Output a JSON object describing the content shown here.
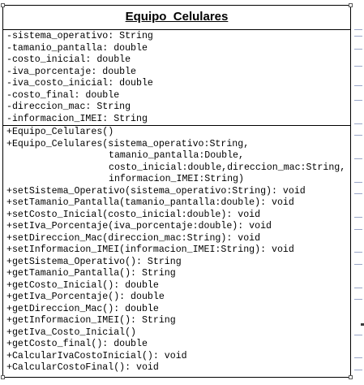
{
  "class_name": "Equipo_Celulares",
  "attributes": [
    "-sistema_operativo: String",
    "-tamanio_pantalla: double",
    "-costo_inicial: double",
    "-iva_porcentaje: double",
    "-iva_costo_inicial: double",
    "-costo_final: double",
    "-direccion_mac: String",
    "-informacion_IMEI: String"
  ],
  "constructors": [
    "+Equipo_Celulares()",
    "+Equipo_Celulares(sistema_operativo:String,",
    "tamanio_pantalla:Double,",
    "costo_inicial:double,direccion_mac:String,",
    "informacion_IMEI:String)"
  ],
  "methods": [
    "+setSistema_Operativo(sistema_operativo:String): void",
    "+setTamanio_Pantalla(tamanio_pantalla:double): void",
    "+setCosto_Inicial(costo_inicial:double): void",
    "+setIva_Porcentaje(iva_porcentaje:double): void",
    "+setDireccion_Mac(direccion_mac:String): void",
    "+setInformacion_IMEI(informacion_IMEI:String): void",
    "+getSistema_Operativo(): String",
    "+getTamanio_Pantalla(): String",
    "+getCosto_Inicial(): double",
    "+getIva_Porcentaje(): double",
    "+getDireccion_Mac(): double",
    "+getInformacion_IMEI(): String",
    "+getIva_Costo_Inicial()",
    "+getCosto_final(): double",
    "+CalcularIvaCostoInicial(): void",
    "+CalcularCostoFinal(): void"
  ]
}
